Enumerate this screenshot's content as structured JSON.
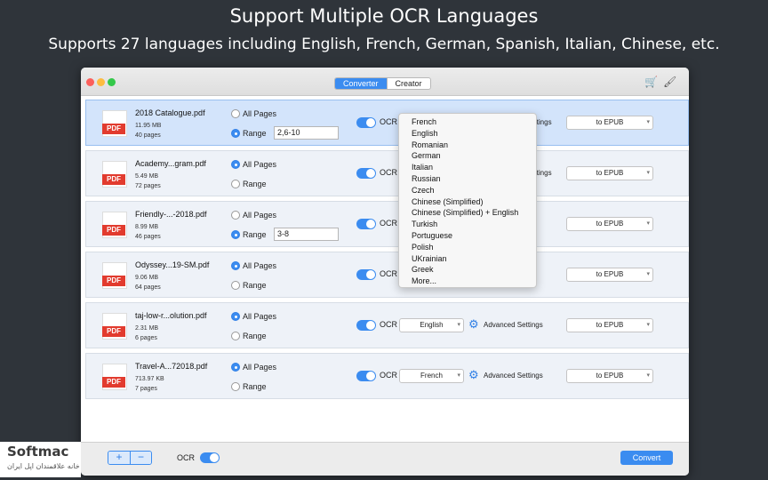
{
  "hero": {
    "title": "Support Multiple OCR Languages",
    "subtitle": "Supports 27 languages including English, French, German, Spanish, Italian, Chinese, etc."
  },
  "toolbar": {
    "tabs": [
      {
        "label": "Converter",
        "active": true
      },
      {
        "label": "Creator",
        "active": false
      }
    ],
    "icons": [
      "cart-icon",
      "brush-icon"
    ]
  },
  "labels": {
    "all_pages": "All Pages",
    "range": "Range",
    "ocr": "OCR",
    "advanced": "Advanced Settings",
    "advanced_partial": "ettings"
  },
  "files": [
    {
      "name": "2018 Catalogue.pdf",
      "size": "11.95 MB",
      "pages": "40 pages",
      "mode": "range",
      "range": "2,6-10",
      "format": "to EPUB",
      "selected": true
    },
    {
      "name": "Academy...gram.pdf",
      "size": "5.49 MB",
      "pages": "72 pages",
      "mode": "all",
      "range": "",
      "format": "to EPUB",
      "selected": false
    },
    {
      "name": "Friendly-...-2018.pdf",
      "size": "8.99 MB",
      "pages": "46 pages",
      "mode": "range",
      "range": "3-8",
      "format": "to EPUB",
      "selected": false
    },
    {
      "name": "Odyssey...19-SM.pdf",
      "size": "9.06 MB",
      "pages": "64 pages",
      "mode": "all",
      "range": "",
      "format": "to EPUB",
      "selected": false
    },
    {
      "name": "taj-low-r...olution.pdf",
      "size": "2.31 MB",
      "pages": "6 pages",
      "mode": "all",
      "range": "",
      "language": "English",
      "format": "to EPUB",
      "selected": false
    },
    {
      "name": "Travel-A...72018.pdf",
      "size": "713.97 KB",
      "pages": "7 pages",
      "mode": "all",
      "range": "",
      "language": "French",
      "format": "to EPUB",
      "selected": false
    }
  ],
  "dropdown": {
    "options": [
      "French",
      "English",
      "Romanian",
      "German",
      "Italian",
      "Russian",
      "Czech",
      "Chinese (Simplified)",
      "Chinese (Simplified) + English",
      "Turkish",
      "Portuguese",
      "Polish",
      "UKrainian",
      "Greek",
      "More..."
    ]
  },
  "bottom": {
    "plus": "+",
    "minus": "−",
    "ocr": "OCR",
    "convert": "Convert"
  },
  "watermark": {
    "name": "Softmac",
    "tagline": "خانه علاقمندان اپل ایران"
  },
  "colors": {
    "accent": "#3b8cf0",
    "background": "#2f343a",
    "row_selected": "#d3e4fb",
    "pdf_red": "#e23b2e"
  }
}
